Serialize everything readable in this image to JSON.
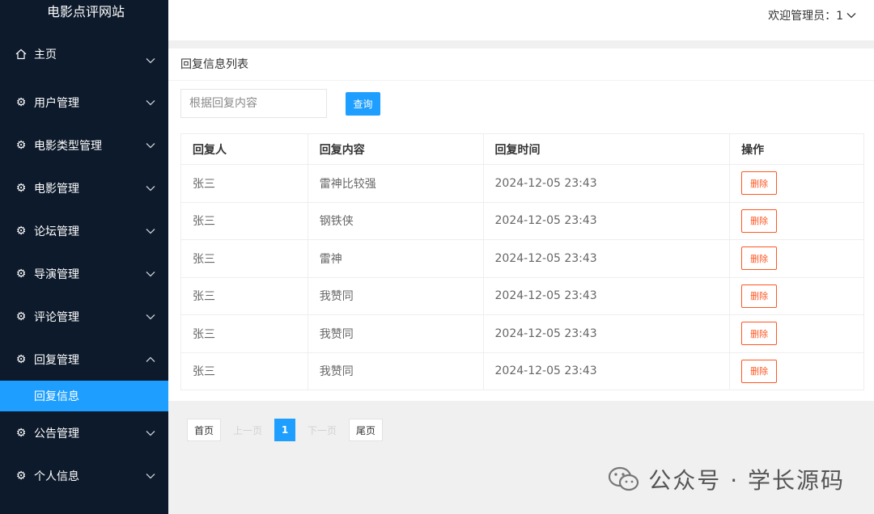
{
  "app": {
    "title": "电影点评网站"
  },
  "header": {
    "welcome": "欢迎管理员：1"
  },
  "sidebar": {
    "items": [
      {
        "label": "主页",
        "icon": "home-icon"
      },
      {
        "label": "用户管理",
        "icon": "gear-icon"
      },
      {
        "label": "电影类型管理",
        "icon": "gear-icon"
      },
      {
        "label": "电影管理",
        "icon": "gear-icon"
      },
      {
        "label": "论坛管理",
        "icon": "gear-icon"
      },
      {
        "label": "导演管理",
        "icon": "gear-icon"
      },
      {
        "label": "评论管理",
        "icon": "gear-icon"
      },
      {
        "label": "回复管理",
        "icon": "gear-icon",
        "expanded": true
      },
      {
        "label": "公告管理",
        "icon": "gear-icon"
      },
      {
        "label": "个人信息",
        "icon": "gear-icon"
      }
    ],
    "active_sub": "回复信息"
  },
  "main": {
    "title": "回复信息列表",
    "search": {
      "placeholder": "根据回复内容",
      "value": ""
    },
    "search_button": "查询",
    "table": {
      "headers": [
        "回复人",
        "回复内容",
        "回复时间",
        "操作"
      ],
      "rows": [
        {
          "user": "张三",
          "content": "雷神比较强",
          "time": "2024-12-05 23:43",
          "action": "删除"
        },
        {
          "user": "张三",
          "content": "钢铁侠",
          "time": "2024-12-05 23:43",
          "action": "删除"
        },
        {
          "user": "张三",
          "content": "雷神",
          "time": "2024-12-05 23:43",
          "action": "删除"
        },
        {
          "user": "张三",
          "content": "我赞同",
          "time": "2024-12-05 23:43",
          "action": "删除"
        },
        {
          "user": "张三",
          "content": "我赞同",
          "time": "2024-12-05 23:43",
          "action": "删除"
        },
        {
          "user": "张三",
          "content": "我赞同",
          "time": "2024-12-05 23:43",
          "action": "删除"
        }
      ]
    }
  },
  "pagination": {
    "first": "首页",
    "prev": "上一页",
    "current": "1",
    "next": "下一页",
    "last": "尾页"
  },
  "watermark": {
    "text": "公众号 · 学长源码"
  },
  "colors": {
    "sidebar_bg": "#0d1a2b",
    "accent": "#1e9fff",
    "danger": "#ff5722"
  }
}
